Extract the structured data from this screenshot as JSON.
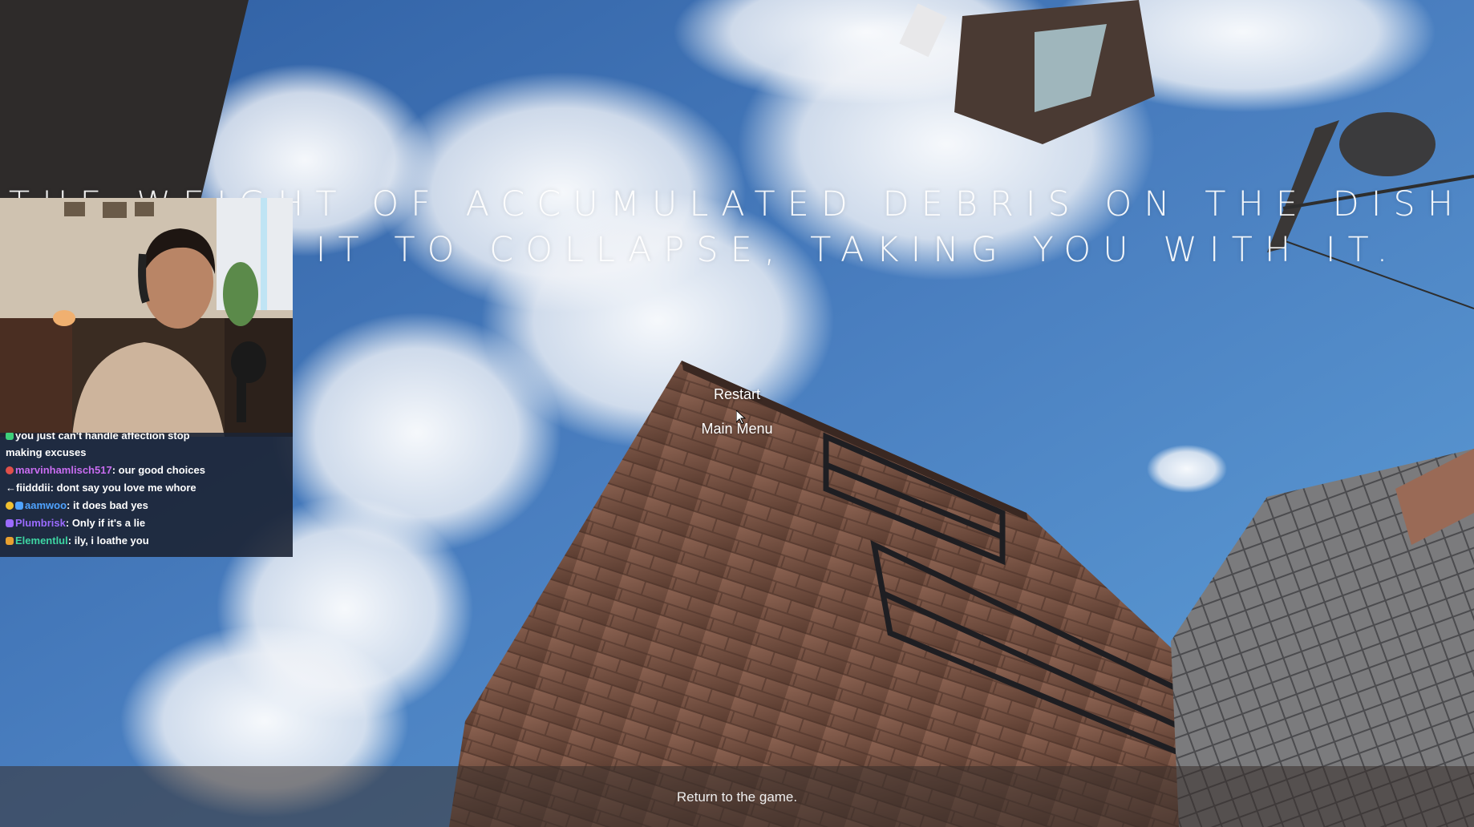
{
  "death_message": {
    "line1": "THE WEIGHT OF ACCUMULATED DEBRIS ON THE DISH",
    "line2": "CAUSED IT TO COLLAPSE, TAKING YOU WITH IT."
  },
  "menu": {
    "restart_label": "Restart",
    "main_menu_label": "Main Menu"
  },
  "footer": {
    "hint": "Return to the game."
  },
  "chat": {
    "messages": [
      {
        "user": "",
        "text": "you just can't handle affection stop"
      },
      {
        "user": "",
        "text": "making excuses"
      },
      {
        "user": "marvinhamlisch517",
        "sep": ":",
        "text": " our good choices",
        "color": "#c86cf0"
      },
      {
        "user": "fiidddii",
        "sep": ":",
        "text": " dont say you love me whore",
        "color": "#ffffff"
      },
      {
        "user": "aamwoo",
        "sep": ":",
        "text": " it does bad yes",
        "color": "#4fa3ff"
      },
      {
        "user": "Plumbrisk",
        "sep": ":",
        "text": " Only if it's a lie",
        "color": "#9b6bff"
      },
      {
        "user": "Elementlul",
        "sep": ":",
        "text": " ily, i loathe you",
        "color": "#3ed6a3"
      }
    ]
  },
  "colors": {
    "sky": "#3d6fae",
    "building": "#7a5444",
    "chat_bg": "#1c2434"
  }
}
